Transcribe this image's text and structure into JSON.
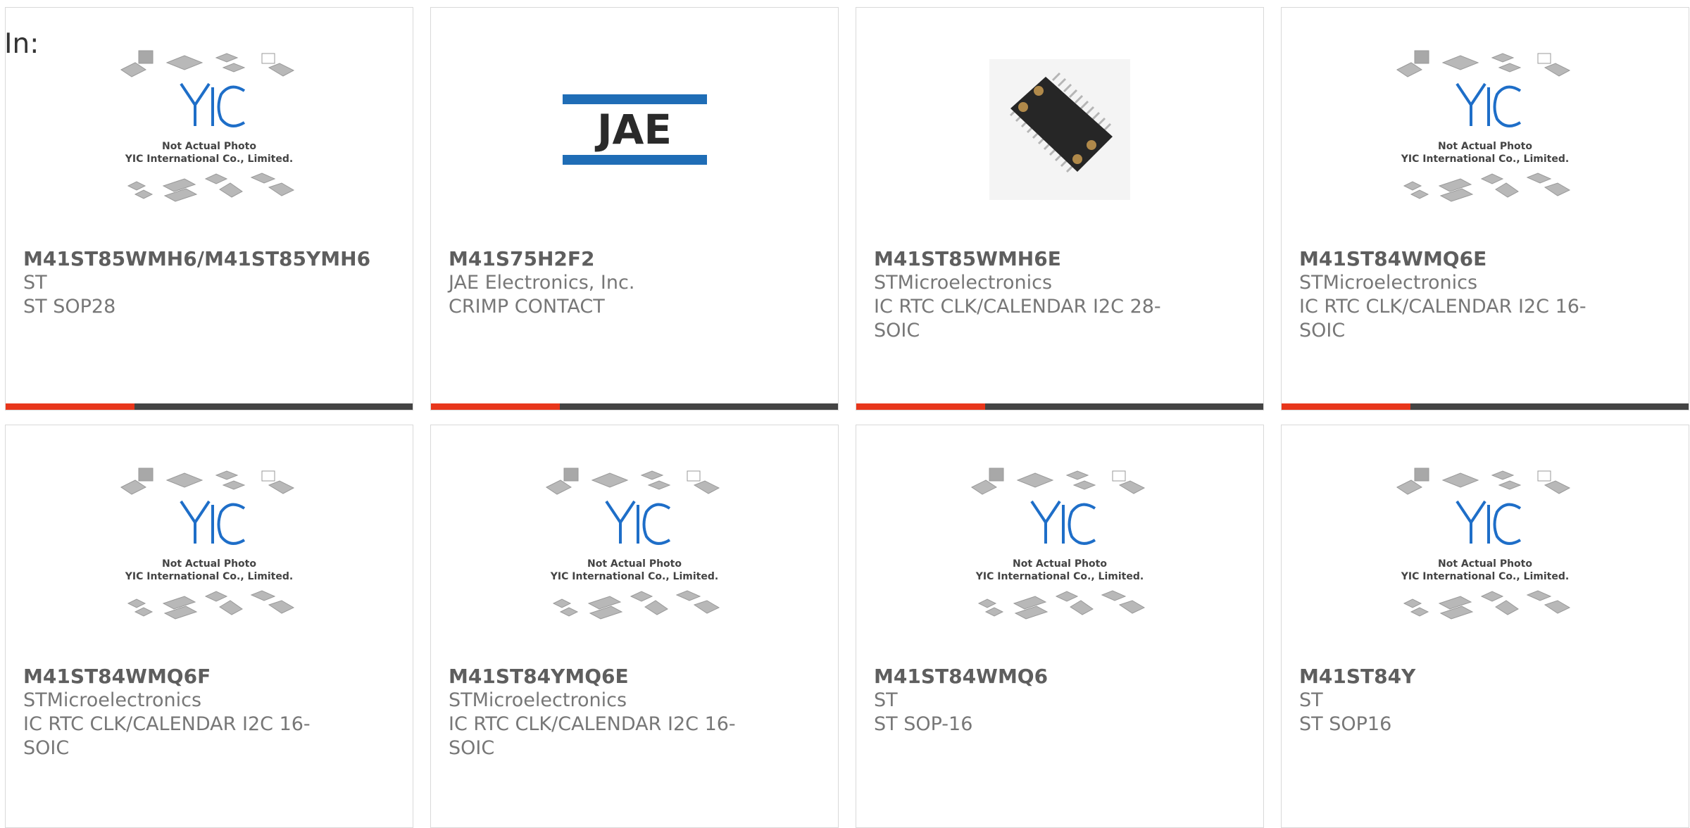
{
  "header": {
    "label": "In:"
  },
  "placeholder_image": {
    "line1": "Not Actual Photo",
    "line2": "YIC International Co., Limited.",
    "logo_text": "YIC"
  },
  "brand_logo": {
    "text": "JAE"
  },
  "colors": {
    "accent": "#e8361b",
    "bar_dark": "#444444",
    "yic_blue": "#1e6ec8",
    "jae_blue": "#1f6db6"
  },
  "products": [
    {
      "part_number": "M41ST85WMH6/M41ST85YMH6",
      "manufacturer": "ST",
      "description": "ST SOP28",
      "image": "yic-placeholder"
    },
    {
      "part_number": "M41S75H2F2",
      "manufacturer": "JAE Electronics, Inc.",
      "description": "CRIMP CONTACT",
      "image": "jae-logo"
    },
    {
      "part_number": "M41ST85WMH6E",
      "manufacturer": "STMicroelectronics",
      "description": "IC RTC CLK/CALENDAR I2C 28-SOIC",
      "image": "chip-photo"
    },
    {
      "part_number": "M41ST84WMQ6E",
      "manufacturer": "STMicroelectronics",
      "description": "IC RTC CLK/CALENDAR I2C 16-SOIC",
      "image": "yic-placeholder"
    },
    {
      "part_number": "M41ST84WMQ6F",
      "manufacturer": "STMicroelectronics",
      "description": "IC RTC CLK/CALENDAR I2C 16-SOIC",
      "image": "yic-placeholder"
    },
    {
      "part_number": "M41ST84YMQ6E",
      "manufacturer": "STMicroelectronics",
      "description": "IC RTC CLK/CALENDAR I2C 16-SOIC",
      "image": "yic-placeholder"
    },
    {
      "part_number": "M41ST84WMQ6",
      "manufacturer": "ST",
      "description": "ST SOP-16",
      "image": "yic-placeholder"
    },
    {
      "part_number": "M41ST84Y",
      "manufacturer": "ST",
      "description": "ST SOP16",
      "image": "yic-placeholder"
    }
  ]
}
